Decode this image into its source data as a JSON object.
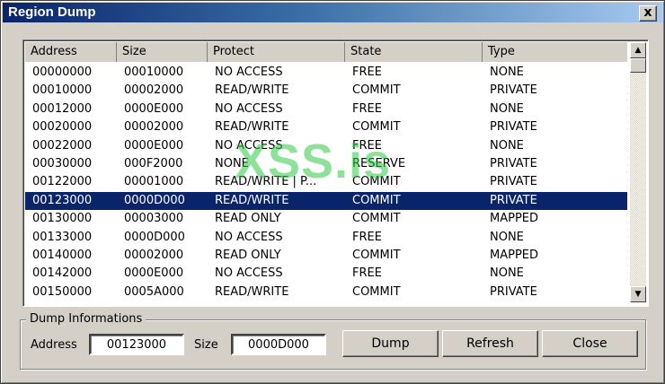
{
  "window": {
    "title": "Region Dump",
    "close_glyph": "x"
  },
  "list": {
    "columns": [
      "Address",
      "Size",
      "Protect",
      "State",
      "Type"
    ],
    "rows": [
      [
        "00000000",
        "00010000",
        "NO ACCESS",
        "FREE",
        "NONE"
      ],
      [
        "00010000",
        "00002000",
        "READ/WRITE",
        "COMMIT",
        "PRIVATE"
      ],
      [
        "00012000",
        "0000E000",
        "NO ACCESS",
        "FREE",
        "NONE"
      ],
      [
        "00020000",
        "00002000",
        "READ/WRITE",
        "COMMIT",
        "PRIVATE"
      ],
      [
        "00022000",
        "0000E000",
        "NO ACCESS",
        "FREE",
        "NONE"
      ],
      [
        "00030000",
        "000F2000",
        "NONE",
        "RESERVE",
        "PRIVATE"
      ],
      [
        "00122000",
        "00001000",
        "READ/WRITE | P...",
        "COMMIT",
        "PRIVATE"
      ],
      [
        "00123000",
        "0000D000",
        "READ/WRITE",
        "COMMIT",
        "PRIVATE"
      ],
      [
        "00130000",
        "00003000",
        "READ ONLY",
        "COMMIT",
        "MAPPED"
      ],
      [
        "00133000",
        "0000D000",
        "NO ACCESS",
        "FREE",
        "NONE"
      ],
      [
        "00140000",
        "00002000",
        "READ ONLY",
        "COMMIT",
        "MAPPED"
      ],
      [
        "00142000",
        "0000E000",
        "NO ACCESS",
        "FREE",
        "NONE"
      ],
      [
        "00150000",
        "0005A000",
        "READ/WRITE",
        "COMMIT",
        "PRIVATE"
      ]
    ],
    "selected_row_index": 7,
    "scrollbar": {
      "up_icon": "arrow-up-icon",
      "down_icon": "arrow-down-icon"
    }
  },
  "watermark": "XSS.is",
  "dump_info": {
    "legend": "Dump Informations",
    "address_label": "Address",
    "address_value": "00123000",
    "size_label": "Size",
    "size_value": "0000D000",
    "dump_button": "Dump",
    "refresh_button": "Refresh",
    "close_button": "Close"
  },
  "colors": {
    "title_gradient_start": "#0a246a",
    "title_gradient_end": "#a6caf0",
    "selection_bg": "#0a246a",
    "face": "#d4d0c8",
    "watermark": "#2fcc45"
  }
}
